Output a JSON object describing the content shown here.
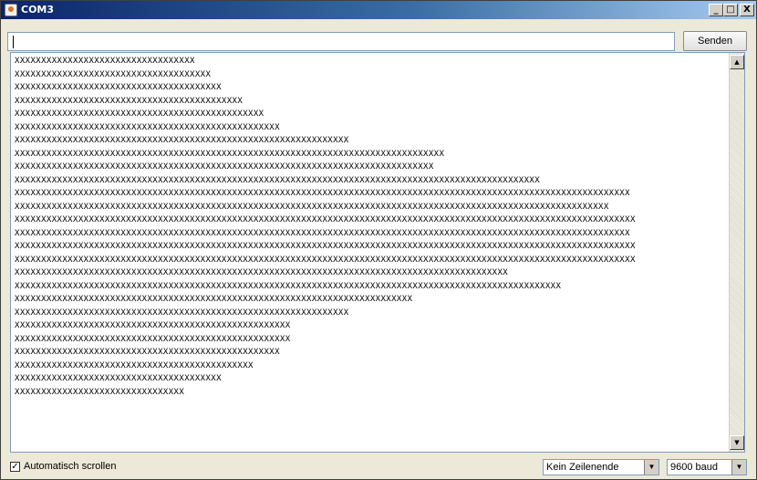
{
  "window": {
    "title": "COM3",
    "controls": {
      "minimize": "_",
      "maximize": "□",
      "close": "X"
    }
  },
  "input": {
    "value": ""
  },
  "send_button": {
    "label": "Senden"
  },
  "output": {
    "lines": [
      "XXXXXXXXXXXXXXXXXXXXXXXXXXXXXXXXXX",
      "XXXXXXXXXXXXXXXXXXXXXXXXXXXXXXXXXXXXX",
      "XXXXXXXXXXXXXXXXXXXXXXXXXXXXXXXXXXXXXXX",
      "XXXXXXXXXXXXXXXXXXXXXXXXXXXXXXXXXXXXXXXXXXX",
      "XXXXXXXXXXXXXXXXXXXXXXXXXXXXXXXXXXXXXXXXXXXXXXX",
      "XXXXXXXXXXXXXXXXXXXXXXXXXXXXXXXXXXXXXXXXXXXXXXXXXX",
      "XXXXXXXXXXXXXXXXXXXXXXXXXXXXXXXXXXXXXXXXXXXXXXXXXXXXXXXXXXXXXXX",
      "XXXXXXXXXXXXXXXXXXXXXXXXXXXXXXXXXXXXXXXXXXXXXXXXXXXXXXXXXXXXXXXXXXXXXXXXXXXXXXXXX",
      "XXXXXXXXXXXXXXXXXXXXXXXXXXXXXXXXXXXXXXXXXXXXXXXXXXXXXXXXXXXXXXXXXXXXXXXXXXXXXXX",
      "XXXXXXXXXXXXXXXXXXXXXXXXXXXXXXXXXXXXXXXXXXXXXXXXXXXXXXXXXXXXXXXXXXXXXXXXXXXXXXXXXXXXXXXXXXXXXXXXXXX",
      "XXXXXXXXXXXXXXXXXXXXXXXXXXXXXXXXXXXXXXXXXXXXXXXXXXXXXXXXXXXXXXXXXXXXXXXXXXXXXXXXXXXXXXXXXXXXXXXXXXXXXXXXXXXXXXXXXXXX",
      "XXXXXXXXXXXXXXXXXXXXXXXXXXXXXXXXXXXXXXXXXXXXXXXXXXXXXXXXXXXXXXXXXXXXXXXXXXXXXXXXXXXXXXXXXXXXXXXXXXXXXXXXXXXXXXXX",
      "XXXXXXXXXXXXXXXXXXXXXXXXXXXXXXXXXXXXXXXXXXXXXXXXXXXXXXXXXXXXXXXXXXXXXXXXXXXXXXXXXXXXXXXXXXXXXXXXXXXXXXXXXXXXXXXXXXXXX",
      "XXXXXXXXXXXXXXXXXXXXXXXXXXXXXXXXXXXXXXXXXXXXXXXXXXXXXXXXXXXXXXXXXXXXXXXXXXXXXXXXXXXXXXXXXXXXXXXXXXXXXXXXXXXXXXXXXXXX",
      "XXXXXXXXXXXXXXXXXXXXXXXXXXXXXXXXXXXXXXXXXXXXXXXXXXXXXXXXXXXXXXXXXXXXXXXXXXXXXXXXXXXXXXXXXXXXXXXXXXXXXXXXXXXXXXXXXXXXX",
      "XXXXXXXXXXXXXXXXXXXXXXXXXXXXXXXXXXXXXXXXXXXXXXXXXXXXXXXXXXXXXXXXXXXXXXXXXXXXXXXXXXXXXXXXXXXXXXXXXXXXXXXXXXXXXXXXXXXXX",
      "XXXXXXXXXXXXXXXXXXXXXXXXXXXXXXXXXXXXXXXXXXXXXXXXXXXXXXXXXXXXXXXXXXXXXXXXXXXXXXXXXXXXXXXXXXXXX",
      "XXXXXXXXXXXXXXXXXXXXXXXXXXXXXXXXXXXXXXXXXXXXXXXXXXXXXXXXXXXXXXXXXXXXXXXXXXXXXXXXXXXXXXXXXXXXXXXXXXXXXXX",
      "XXXXXXXXXXXXXXXXXXXXXXXXXXXXXXXXXXXXXXXXXXXXXXXXXXXXXXXXXXXXXXXXXXXXXXXXXXX",
      "XXXXXXXXXXXXXXXXXXXXXXXXXXXXXXXXXXXXXXXXXXXXXXXXXXXXXXXXXXXXXXX",
      "XXXXXXXXXXXXXXXXXXXXXXXXXXXXXXXXXXXXXXXXXXXXXXXXXXXX",
      "XXXXXXXXXXXXXXXXXXXXXXXXXXXXXXXXXXXXXXXXXXXXXXXXXXXX",
      "XXXXXXXXXXXXXXXXXXXXXXXXXXXXXXXXXXXXXXXXXXXXXXXXXX",
      "XXXXXXXXXXXXXXXXXXXXXXXXXXXXXXXXXXXXXXXXXXXXX",
      "XXXXXXXXXXXXXXXXXXXXXXXXXXXXXXXXXXXXXXX",
      "XXXXXXXXXXXXXXXXXXXXXXXXXXXXXXXX"
    ]
  },
  "scrollbar": {
    "up_arrow": "▲",
    "down_arrow": "▼"
  },
  "footer": {
    "autoscroll": {
      "label": "Automatisch scrollen",
      "checked": true,
      "mark": "✓"
    },
    "line_ending": {
      "value": "Kein Zeilenende",
      "arrow": "▼"
    },
    "baud_rate": {
      "value": "9600 baud",
      "arrow": "▼"
    }
  }
}
